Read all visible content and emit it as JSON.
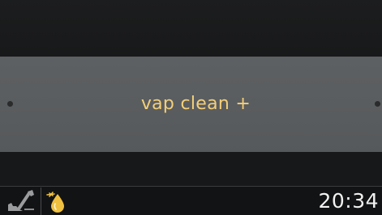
{
  "menu": {
    "label": "vap clean +"
  },
  "status_bar": {
    "time": "20:34",
    "icons": [
      "maintenance-brush-icon",
      "oil-drop-icon"
    ]
  },
  "colors": {
    "menu_text": "#f4cf78",
    "band": "#5a5d5f",
    "background": "#161718",
    "oil_icon": "#f0c040",
    "clock_text": "#f2f2f2"
  }
}
